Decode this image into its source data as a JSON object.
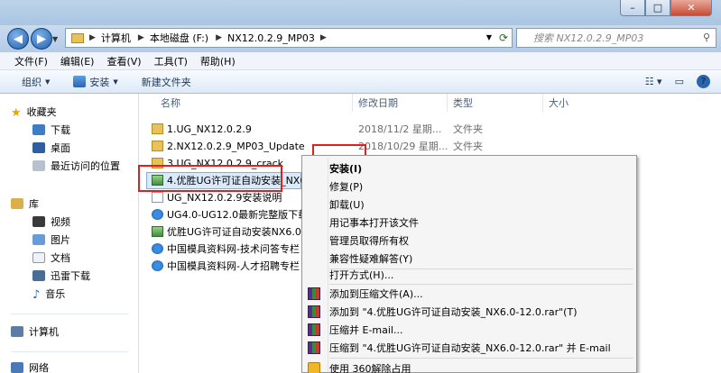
{
  "window": {
    "controls": {
      "minimize": "–",
      "maximize": "□",
      "close": "✕"
    }
  },
  "nav": {
    "back": "◀",
    "forward": "▶",
    "breadcrumbs": [
      "计算机",
      "本地磁盘 (F:)",
      "NX12.0.2.9_MP03"
    ],
    "search_placeholder": "搜索 NX12.0.2.9_MP03"
  },
  "menubar": [
    "文件(F)",
    "编辑(E)",
    "查看(V)",
    "工具(T)",
    "帮助(H)"
  ],
  "toolbar": {
    "organize": "组织",
    "install": "安装",
    "new_folder": "新建文件夹"
  },
  "sidebar": {
    "favorites": "收藏夹",
    "downloads": "下载",
    "desktop": "桌面",
    "recent": "最近访问的位置",
    "libraries": "库",
    "videos": "视频",
    "pictures": "图片",
    "documents": "文档",
    "xunlei": "迅雷下载",
    "music": "音乐",
    "computer": "计算机",
    "network": "网络"
  },
  "columns": {
    "name": "名称",
    "date": "修改日期",
    "type": "类型",
    "size": "大小"
  },
  "files": [
    {
      "name": "1.UG_NX12.0.2.9",
      "date": "2018/11/2 星期...",
      "type": "文件夹",
      "icon": "folder-icon"
    },
    {
      "name": "2.NX12.0.2.9_MP03_Update",
      "date": "2018/10/29 星期...",
      "type": "文件夹",
      "icon": "folder-icon"
    },
    {
      "name": "3.UG_NX12.0.2.9_crack",
      "date": "",
      "type": "",
      "icon": "folder-icon"
    },
    {
      "name": "4.优胜UG许可证自动安装_NX6.0",
      "date": "",
      "type": "",
      "icon": "setup-icon"
    },
    {
      "name": "UG_NX12.0.2.9安装说明",
      "date": "",
      "type": "",
      "icon": "text-icon"
    },
    {
      "name": "UG4.0-UG12.0最新完整版下载",
      "date": "",
      "type": "",
      "icon": "ie-icon"
    },
    {
      "name": "优胜UG许可证自动安装NX6.0-1",
      "date": "",
      "type": "",
      "icon": "setup-icon"
    },
    {
      "name": "中国模具资料网-技术问答专栏",
      "date": "",
      "type": "",
      "icon": "ie-icon"
    },
    {
      "name": "中国模具资料网-人才招聘专栏",
      "date": "",
      "type": "",
      "icon": "ie-icon"
    }
  ],
  "context_menu": {
    "install": "安装(I)",
    "repair": "修复(P)",
    "uninstall": "卸载(U)",
    "open_notepad": "用记事本打开该文件",
    "take_ownership": "管理员取得所有权",
    "compat": "兼容性疑难解答(Y)",
    "open_with": "打开方式(H)...",
    "add_archive": "添加到压缩文件(A)...",
    "add_rar": "添加到 \"4.优胜UG许可证自动安装_NX6.0-12.0.rar\"(T)",
    "compress_email": "压缩并 E-mail...",
    "compress_rar_email": "压缩到 \"4.优胜UG许可证自动安装_NX6.0-12.0.rar\" 并 E-mail",
    "unzip360": "使用 360解除占用"
  }
}
